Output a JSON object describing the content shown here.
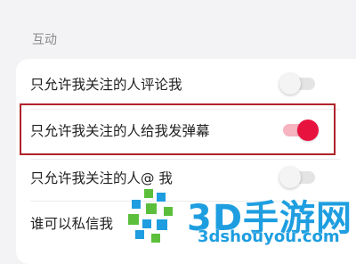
{
  "section": {
    "label": "互动"
  },
  "settings": [
    {
      "label": "只允许我关注的人评论我",
      "enabled": false
    },
    {
      "label": "只允许我关注的人给我发弹幕",
      "enabled": true
    },
    {
      "label": "只允许我关注的人@ 我",
      "enabled": false
    },
    {
      "label": "谁可以私信我"
    }
  ],
  "watermark": {
    "title": "3D手游网",
    "site": "3dshouyou.com"
  },
  "colors": {
    "accent": "#e8123f",
    "highlight_border": "#b0232b",
    "watermark_blue": "#1e9ee0",
    "watermark_green": "#5bbf3c"
  }
}
